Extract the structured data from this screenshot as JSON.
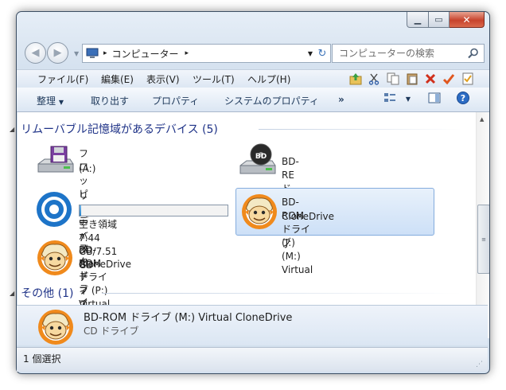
{
  "address": {
    "path": [
      "コンピューター"
    ]
  },
  "search": {
    "placeholder": "コンピューターの検索"
  },
  "menu": [
    "ファイル(F)",
    "編集(E)",
    "表示(V)",
    "ツール(T)",
    "ヘルプ(H)"
  ],
  "toolbar_icons": [
    "up-folder-icon",
    "cut-icon",
    "copy-icon",
    "paste-icon",
    "delete-icon",
    "check-icon",
    "properties-icon"
  ],
  "commands": {
    "organize": "整理",
    "eject": "取り出す",
    "properties": "プロパティ",
    "system_properties": "システムのプロパティ",
    "more": "»"
  },
  "groups": {
    "removable": {
      "title": "リムーバブル記憶域があるデバイス (5)"
    },
    "other": {
      "title": "その他 (1)"
    }
  },
  "items": {
    "floppy": {
      "name1": "フロッピー ディスク ドライブ",
      "name2": "(A:)",
      "icon": "floppy-drive-icon"
    },
    "bdre": {
      "name": "BD-RE ドライブ (J:)",
      "icon": "bd-drive-icon"
    },
    "removable": {
      "name": "リムーバブル ディスク (L:)",
      "free": "空き領域 7.44 GB/7.51 GB",
      "used_fraction": 0.01,
      "icon": "removable-disk-icon"
    },
    "bdrom_m": {
      "name1": "BD-ROM ドライブ (M:) Virtual",
      "name2": "CloneDrive",
      "icon": "clonedrive-sheep-icon"
    },
    "bdrom_p": {
      "name1": "BD-ROM ドライブ (P:) Virtual",
      "name2": "CloneDrive",
      "icon": "clonedrive-sheep-icon"
    }
  },
  "details": {
    "title": "BD-ROM ドライブ (M:) Virtual CloneDrive",
    "subtitle": "CD ドライブ"
  },
  "status": {
    "text": "1 個選択"
  },
  "colors": {
    "accent": "#1e3287",
    "selection": "#cde0f7",
    "progress": "#2b85c9"
  }
}
